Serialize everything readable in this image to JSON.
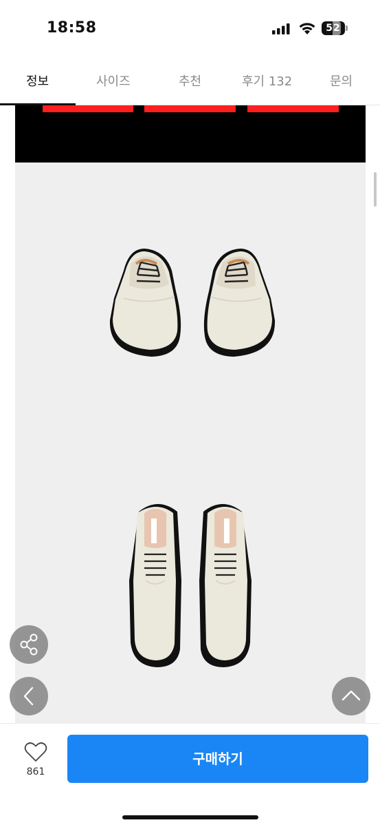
{
  "status_bar": {
    "time": "18:58",
    "battery_level": "52"
  },
  "tabs": [
    {
      "label": "정보",
      "active": true
    },
    {
      "label": "사이즈",
      "active": false
    },
    {
      "label": "추천",
      "active": false
    },
    {
      "label": "후기 132",
      "active": false
    },
    {
      "label": "문의",
      "active": false
    }
  ],
  "product_images": {
    "banner_accent_color": "#ff1f1f",
    "shoe_color": "#ebe8dc",
    "sole_color": "#111111"
  },
  "floating_actions": {
    "share_icon": "share-icon",
    "back_icon": "chevron-left-icon",
    "top_icon": "chevron-up-icon"
  },
  "bottom_bar": {
    "like_icon": "heart-icon",
    "like_count": "861",
    "buy_label": "구매하기",
    "buy_color": "#1a86f5"
  }
}
